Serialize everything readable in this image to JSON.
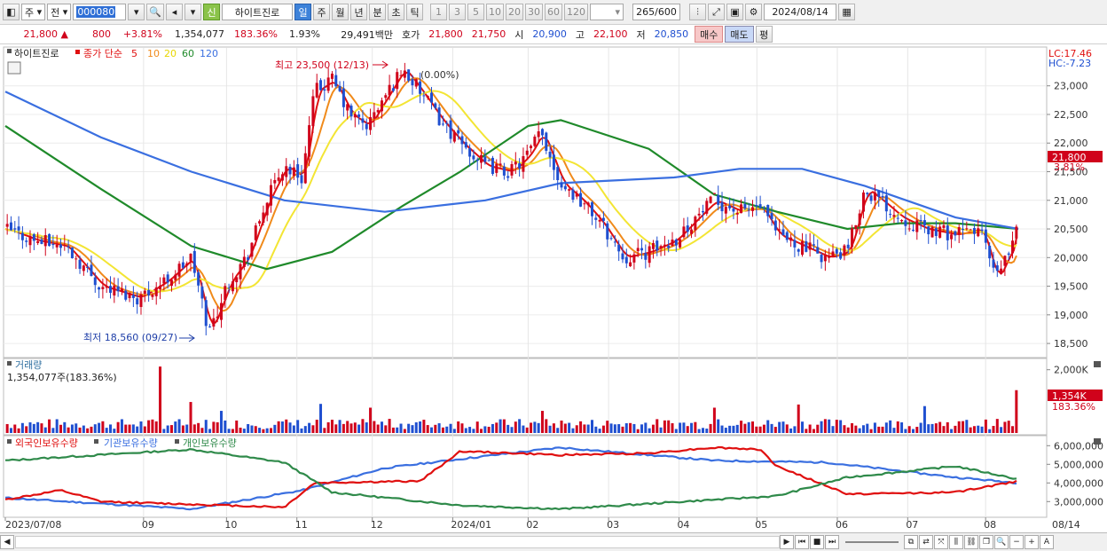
{
  "toolbar": {
    "period_select": "주",
    "prev_label": "전",
    "code": "000080",
    "new_badge": "신",
    "stock_name": "하이트진로",
    "tab_day": "일",
    "tab_week": "주",
    "tab_month": "월",
    "tab_year": "년",
    "tab_min": "분",
    "tab_sec": "초",
    "tab_tick": "틱",
    "intervals": [
      "1",
      "3",
      "5",
      "10",
      "20",
      "30",
      "60",
      "120"
    ],
    "count": "265",
    "count_total": "/600",
    "date": "2024/08/14"
  },
  "quote": {
    "price": "21,800",
    "change_arrow": "▲",
    "change": "800",
    "change_pct": "+3.81%",
    "volume": "1,354,077",
    "volume_pct": "183.36%",
    "turnover_pct": "1.93%",
    "amount": "29,491백만",
    "ask_label": "호가",
    "ask": "21,800",
    "bid": "21,750",
    "open_label": "시",
    "open": "20,900",
    "high_label": "고",
    "high": "22,100",
    "low_label": "저",
    "low": "20,850",
    "buy_label": "매수",
    "sell_label": "매도",
    "avg_label": "평"
  },
  "legend": {
    "name": "하이트진로",
    "ma_label": "종가 단순",
    "ma_periods": [
      "5",
      "10",
      "20",
      "60",
      "120"
    ],
    "lc": "LC:17.46",
    "hc": "HC:-7.23",
    "max_note": "최고 23,500 (12/13)",
    "max_note2": "(0.00%)",
    "min_note": "최저 18,560 (09/27)",
    "price_tag": "21,800",
    "price_tag_pct": "3.81%"
  },
  "volume_panel": {
    "title": "거래량",
    "value_note": "1,354,077주(183.36%)",
    "tag": "1,354K",
    "tag_pct": "183.36%"
  },
  "holdings_panel": {
    "legend": [
      "외국인보유수량",
      "기관보유수량",
      "개인보유수량"
    ]
  },
  "x_labels": [
    "2023/07/08",
    "09",
    "10",
    "11",
    "12",
    "2024/01",
    "02",
    "03",
    "04",
    "05",
    "06",
    "07",
    "08",
    "08/14"
  ],
  "colors": {
    "up": "#d0021b",
    "down": "#1f4fd0",
    "ma5": "#e01010",
    "ma10": "#f08a1a",
    "ma20": "#f3e534",
    "ma60": "#1f8a2a",
    "ma120": "#3a6fe0",
    "foreign": "#3a6fe0",
    "institution": "#e01010",
    "individual": "#2f8a4a"
  },
  "chart_data": [
    {
      "type": "candlestick",
      "title": "하이트진로",
      "y_ticks": [
        "23,000",
        "22,500",
        "22,000",
        "21,500",
        "21,000",
        "20,500",
        "20,000",
        "19,500",
        "19,000",
        "18,500"
      ],
      "ylim": [
        18300,
        23600
      ],
      "last_close": 21800,
      "high": 23500,
      "low": 18560,
      "close_path": [
        {
          "d": "2023/07/08",
          "v": 20500
        },
        {
          "d": "2023/07/20",
          "v": 20300
        },
        {
          "d": "2023/08/01",
          "v": 20200
        },
        {
          "d": "2023/08/15",
          "v": 19500
        },
        {
          "d": "2023/08/30",
          "v": 19300
        },
        {
          "d": "2023/09/10",
          "v": 19600
        },
        {
          "d": "2023/09/20",
          "v": 20000
        },
        {
          "d": "2023/09/27",
          "v": 18700
        },
        {
          "d": "2023/10/05",
          "v": 19600
        },
        {
          "d": "2023/10/12",
          "v": 20000
        },
        {
          "d": "2023/10/20",
          "v": 21000
        },
        {
          "d": "2023/10/27",
          "v": 21600
        },
        {
          "d": "2023/11/03",
          "v": 21400
        },
        {
          "d": "2023/11/08",
          "v": 22900
        },
        {
          "d": "2023/11/15",
          "v": 23100
        },
        {
          "d": "2023/11/22",
          "v": 22500
        },
        {
          "d": "2023/11/29",
          "v": 22300
        },
        {
          "d": "2023/12/06",
          "v": 22800
        },
        {
          "d": "2023/12/13",
          "v": 23300
        },
        {
          "d": "2023/12/20",
          "v": 22900
        },
        {
          "d": "2023/12/28",
          "v": 22400
        },
        {
          "d": "2024/01/05",
          "v": 22000
        },
        {
          "d": "2024/01/15",
          "v": 21600
        },
        {
          "d": "2024/01/25",
          "v": 21500
        },
        {
          "d": "2024/02/01",
          "v": 21800
        },
        {
          "d": "2024/02/06",
          "v": 22200
        },
        {
          "d": "2024/02/14",
          "v": 21300
        },
        {
          "d": "2024/02/22",
          "v": 21000
        },
        {
          "d": "2024/03/01",
          "v": 20600
        },
        {
          "d": "2024/03/10",
          "v": 20000
        },
        {
          "d": "2024/03/20",
          "v": 20100
        },
        {
          "d": "2024/03/30",
          "v": 20300
        },
        {
          "d": "2024/04/08",
          "v": 20700
        },
        {
          "d": "2024/04/15",
          "v": 21000
        },
        {
          "d": "2024/04/25",
          "v": 20800
        },
        {
          "d": "2024/05/03",
          "v": 20900
        },
        {
          "d": "2024/05/10",
          "v": 20400
        },
        {
          "d": "2024/05/20",
          "v": 20200
        },
        {
          "d": "2024/05/30",
          "v": 20000
        },
        {
          "d": "2024/06/07",
          "v": 20100
        },
        {
          "d": "2024/06/14",
          "v": 21200
        },
        {
          "d": "2024/06/20",
          "v": 21000
        },
        {
          "d": "2024/06/28",
          "v": 20700
        },
        {
          "d": "2024/07/08",
          "v": 20500
        },
        {
          "d": "2024/07/20",
          "v": 20400
        },
        {
          "d": "2024/07/30",
          "v": 20500
        },
        {
          "d": "2024/08/05",
          "v": 19600
        },
        {
          "d": "2024/08/09",
          "v": 20000
        },
        {
          "d": "2024/08/13",
          "v": 20300
        },
        {
          "d": "2024/08/14",
          "v": 21800
        }
      ],
      "ma120_path": [
        {
          "d": "2023/07/08",
          "v": 22900
        },
        {
          "d": "2023/08/15",
          "v": 22100
        },
        {
          "d": "2023/09/20",
          "v": 21500
        },
        {
          "d": "2023/10/27",
          "v": 21000
        },
        {
          "d": "2023/12/06",
          "v": 20800
        },
        {
          "d": "2024/01/15",
          "v": 21000
        },
        {
          "d": "2024/02/14",
          "v": 21300
        },
        {
          "d": "2024/03/30",
          "v": 21400
        },
        {
          "d": "2024/04/25",
          "v": 21550
        },
        {
          "d": "2024/05/20",
          "v": 21550
        },
        {
          "d": "2024/06/14",
          "v": 21250
        },
        {
          "d": "2024/07/20",
          "v": 20700
        },
        {
          "d": "2024/08/14",
          "v": 20500
        }
      ],
      "ma60_path": [
        {
          "d": "2023/07/08",
          "v": 22300
        },
        {
          "d": "2023/08/15",
          "v": 21200
        },
        {
          "d": "2023/09/20",
          "v": 20200
        },
        {
          "d": "2023/10/20",
          "v": 19800
        },
        {
          "d": "2023/11/15",
          "v": 20100
        },
        {
          "d": "2023/12/13",
          "v": 20900
        },
        {
          "d": "2024/01/05",
          "v": 21500
        },
        {
          "d": "2024/02/01",
          "v": 22300
        },
        {
          "d": "2024/02/14",
          "v": 22400
        },
        {
          "d": "2024/03/20",
          "v": 21900
        },
        {
          "d": "2024/04/15",
          "v": 21100
        },
        {
          "d": "2024/05/10",
          "v": 20800
        },
        {
          "d": "2024/06/07",
          "v": 20500
        },
        {
          "d": "2024/06/28",
          "v": 20600
        },
        {
          "d": "2024/07/20",
          "v": 20600
        },
        {
          "d": "2024/08/14",
          "v": 20500
        }
      ]
    },
    {
      "type": "bar",
      "title": "거래량",
      "y_ticks": [
        "2,000K"
      ],
      "ylim": [
        0,
        2300000
      ],
      "last_value": 1354077
    },
    {
      "type": "line",
      "title": "외국인보유수량 · 기관보유수량 · 개인보유수량",
      "y_ticks": [
        "6,000,000",
        "5,000,000",
        "4,000,000",
        "3,000,000"
      ],
      "ylim": [
        2300000,
        6300000
      ],
      "series": [
        {
          "name": "외국인보유수량",
          "points": [
            {
              "d": "2023/07/08",
              "v": 3200000
            },
            {
              "d": "2023/09/20",
              "v": 2600000
            },
            {
              "d": "2023/11/03",
              "v": 3600000
            },
            {
              "d": "2023/12/06",
              "v": 4800000
            },
            {
              "d": "2024/01/25",
              "v": 5600000
            },
            {
              "d": "2024/02/14",
              "v": 5900000
            },
            {
              "d": "2024/04/15",
              "v": 5200000
            },
            {
              "d": "2024/05/30",
              "v": 5100000
            },
            {
              "d": "2024/07/20",
              "v": 4300000
            },
            {
              "d": "2024/08/14",
              "v": 4000000
            }
          ]
        },
        {
          "name": "기관보유수량",
          "points": [
            {
              "d": "2023/07/08",
              "v": 3100000
            },
            {
              "d": "2023/07/30",
              "v": 3600000
            },
            {
              "d": "2023/08/15",
              "v": 3000000
            },
            {
              "d": "2023/10/27",
              "v": 2700000
            },
            {
              "d": "2023/11/08",
              "v": 4000000
            },
            {
              "d": "2023/12/20",
              "v": 4100000
            },
            {
              "d": "2024/01/05",
              "v": 5700000
            },
            {
              "d": "2024/02/14",
              "v": 5500000
            },
            {
              "d": "2024/03/20",
              "v": 5600000
            },
            {
              "d": "2024/04/15",
              "v": 5900000
            },
            {
              "d": "2024/05/03",
              "v": 5800000
            },
            {
              "d": "2024/05/10",
              "v": 4900000
            },
            {
              "d": "2024/06/07",
              "v": 3400000
            },
            {
              "d": "2024/07/20",
              "v": 3500000
            },
            {
              "d": "2024/08/14",
              "v": 4100000
            }
          ]
        },
        {
          "name": "개인보유수량",
          "points": [
            {
              "d": "2023/07/08",
              "v": 5200000
            },
            {
              "d": "2023/09/20",
              "v": 5800000
            },
            {
              "d": "2023/10/27",
              "v": 5100000
            },
            {
              "d": "2023/11/15",
              "v": 3500000
            },
            {
              "d": "2024/01/05",
              "v": 2800000
            },
            {
              "d": "2024/02/14",
              "v": 2600000
            },
            {
              "d": "2024/04/15",
              "v": 3100000
            },
            {
              "d": "2024/05/10",
              "v": 3300000
            },
            {
              "d": "2024/06/07",
              "v": 4300000
            },
            {
              "d": "2024/07/20",
              "v": 4900000
            },
            {
              "d": "2024/08/14",
              "v": 4200000
            }
          ]
        }
      ]
    }
  ]
}
